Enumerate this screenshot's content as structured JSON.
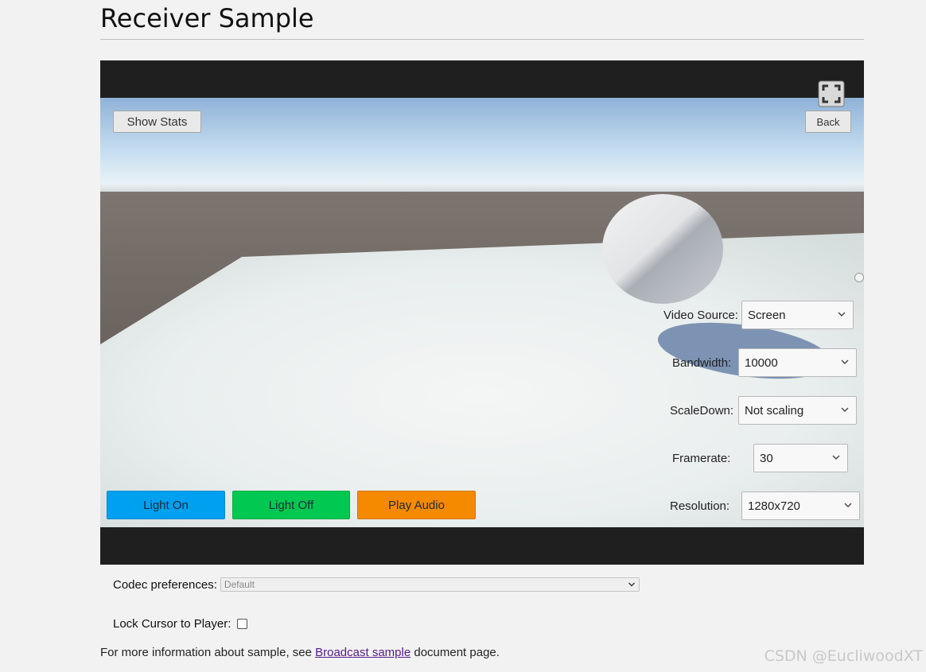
{
  "page": {
    "title": "Receiver Sample"
  },
  "player": {
    "show_stats_label": "Show Stats",
    "back_label": "Back",
    "fullscreen_icon": "fullscreen-icon"
  },
  "controls": {
    "video_source": {
      "label": "Video Source:",
      "value": "Screen"
    },
    "bandwidth": {
      "label": "Bandwidth:",
      "value": "10000"
    },
    "scale_down": {
      "label": "ScaleDown:",
      "value": "Not scaling"
    },
    "framerate": {
      "label": "Framerate:",
      "value": "30"
    },
    "resolution": {
      "label": "Resolution:",
      "value": "1280x720"
    }
  },
  "actions": {
    "light_on": {
      "label": "Light On",
      "color": "#00a0f0"
    },
    "light_off": {
      "label": "Light Off",
      "color": "#00c851"
    },
    "play_audio": {
      "label": "Play Audio",
      "color": "#f58a00"
    }
  },
  "codec": {
    "label": "Codec preferences:",
    "value": "Default"
  },
  "lock_cursor": {
    "label": "Lock Cursor to Player:",
    "checked": false
  },
  "info": {
    "prefix": "For more information about sample, see ",
    "link_text": "Broadcast sample",
    "suffix": " document page."
  },
  "watermark": "CSDN @EucliwoodXT",
  "colors": {
    "player_bg": "#1f1f1f",
    "link": "#551a8b",
    "page_bg": "#f2f2f2"
  }
}
